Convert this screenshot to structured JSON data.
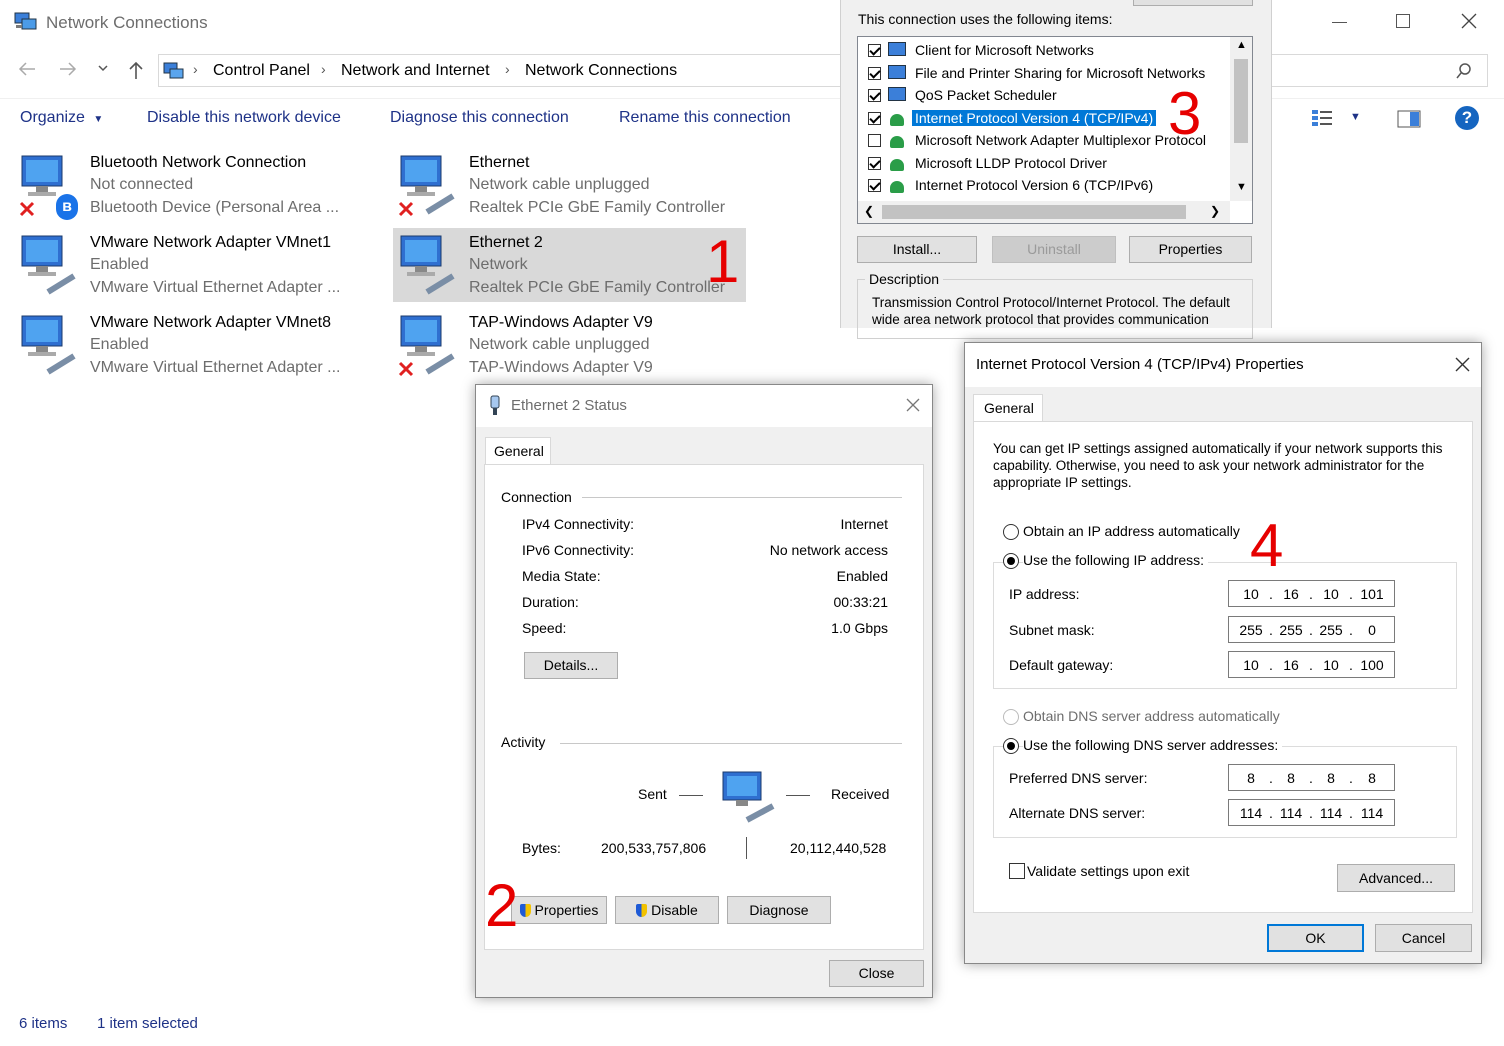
{
  "window": {
    "title": "Network Connections"
  },
  "breadcrumb": [
    "Control Panel",
    "Network and Internet",
    "Network Connections"
  ],
  "toolbar": {
    "organize": "Organize",
    "disable": "Disable this network device",
    "diagnose": "Diagnose this connection",
    "rename": "Rename this connection"
  },
  "adapters": [
    {
      "name": "Bluetooth Network Connection",
      "status": "Not connected",
      "device": "Bluetooth Device (Personal Area ..."
    },
    {
      "name": "Ethernet",
      "status": "Network cable unplugged",
      "device": "Realtek PCIe GbE Family Controller"
    },
    {
      "name": "VMware Network Adapter VMnet1",
      "status": "Enabled",
      "device": "VMware Virtual Ethernet Adapter ..."
    },
    {
      "name": "Ethernet 2",
      "status": "Network",
      "device": "Realtek PCIe GbE Family Controller"
    },
    {
      "name": "VMware Network Adapter VMnet8",
      "status": "Enabled",
      "device": "VMware Virtual Ethernet Adapter ..."
    },
    {
      "name": "TAP-Windows Adapter V9",
      "status": "Network cable unplugged",
      "device": "TAP-Windows Adapter V9"
    }
  ],
  "statusbar": {
    "items": "6 items",
    "selected": "1 item selected"
  },
  "props_panel": {
    "heading": "This connection uses the following items:",
    "items": [
      "Client for Microsoft Networks",
      "File and Printer Sharing for Microsoft Networks",
      "QoS Packet Scheduler",
      "Internet Protocol Version 4 (TCP/IPv4)",
      "Microsoft Network Adapter Multiplexor Protocol",
      "Microsoft LLDP Protocol Driver",
      "Internet Protocol Version 6 (TCP/IPv6)"
    ],
    "install": "Install...",
    "uninstall": "Uninstall",
    "properties": "Properties",
    "description_label": "Description",
    "description_text": "Transmission Control Protocol/Internet Protocol. The default wide area network protocol that provides communication"
  },
  "status_dialog": {
    "title": "Ethernet 2 Status",
    "tab": "General",
    "connection_label": "Connection",
    "rows": [
      {
        "k": "IPv4 Connectivity:",
        "v": "Internet"
      },
      {
        "k": "IPv6 Connectivity:",
        "v": "No network access"
      },
      {
        "k": "Media State:",
        "v": "Enabled"
      },
      {
        "k": "Duration:",
        "v": "00:33:21"
      },
      {
        "k": "Speed:",
        "v": "1.0 Gbps"
      }
    ],
    "details": "Details...",
    "activity_label": "Activity",
    "sent": "Sent",
    "received": "Received",
    "bytes_label": "Bytes:",
    "bytes_sent": "200,533,757,806",
    "bytes_received": "20,112,440,528",
    "properties": "Properties",
    "disable": "Disable",
    "diagnose": "Diagnose",
    "close": "Close"
  },
  "ipv4_dialog": {
    "title": "Internet Protocol Version 4 (TCP/IPv4) Properties",
    "tab": "General",
    "intro": "You can get IP settings assigned automatically if your network supports this capability. Otherwise, you need to ask your network administrator for the appropriate IP settings.",
    "obtain_ip": "Obtain an IP address automatically",
    "use_ip": "Use the following IP address:",
    "ip_label": "IP address:",
    "ip": [
      "10",
      "16",
      "10",
      "101"
    ],
    "mask_label": "Subnet mask:",
    "mask": [
      "255",
      "255",
      "255",
      "0"
    ],
    "gw_label": "Default gateway:",
    "gw": [
      "10",
      "16",
      "10",
      "100"
    ],
    "obtain_dns": "Obtain DNS server address automatically",
    "use_dns": "Use the following DNS server addresses:",
    "pdns_label": "Preferred DNS server:",
    "pdns": [
      "8",
      "8",
      "8",
      "8"
    ],
    "adns_label": "Alternate DNS server:",
    "adns": [
      "114",
      "114",
      "114",
      "114"
    ],
    "validate": "Validate settings upon exit",
    "advanced": "Advanced...",
    "ok": "OK",
    "cancel": "Cancel"
  },
  "annotations": [
    "1",
    "2",
    "3",
    "4"
  ]
}
